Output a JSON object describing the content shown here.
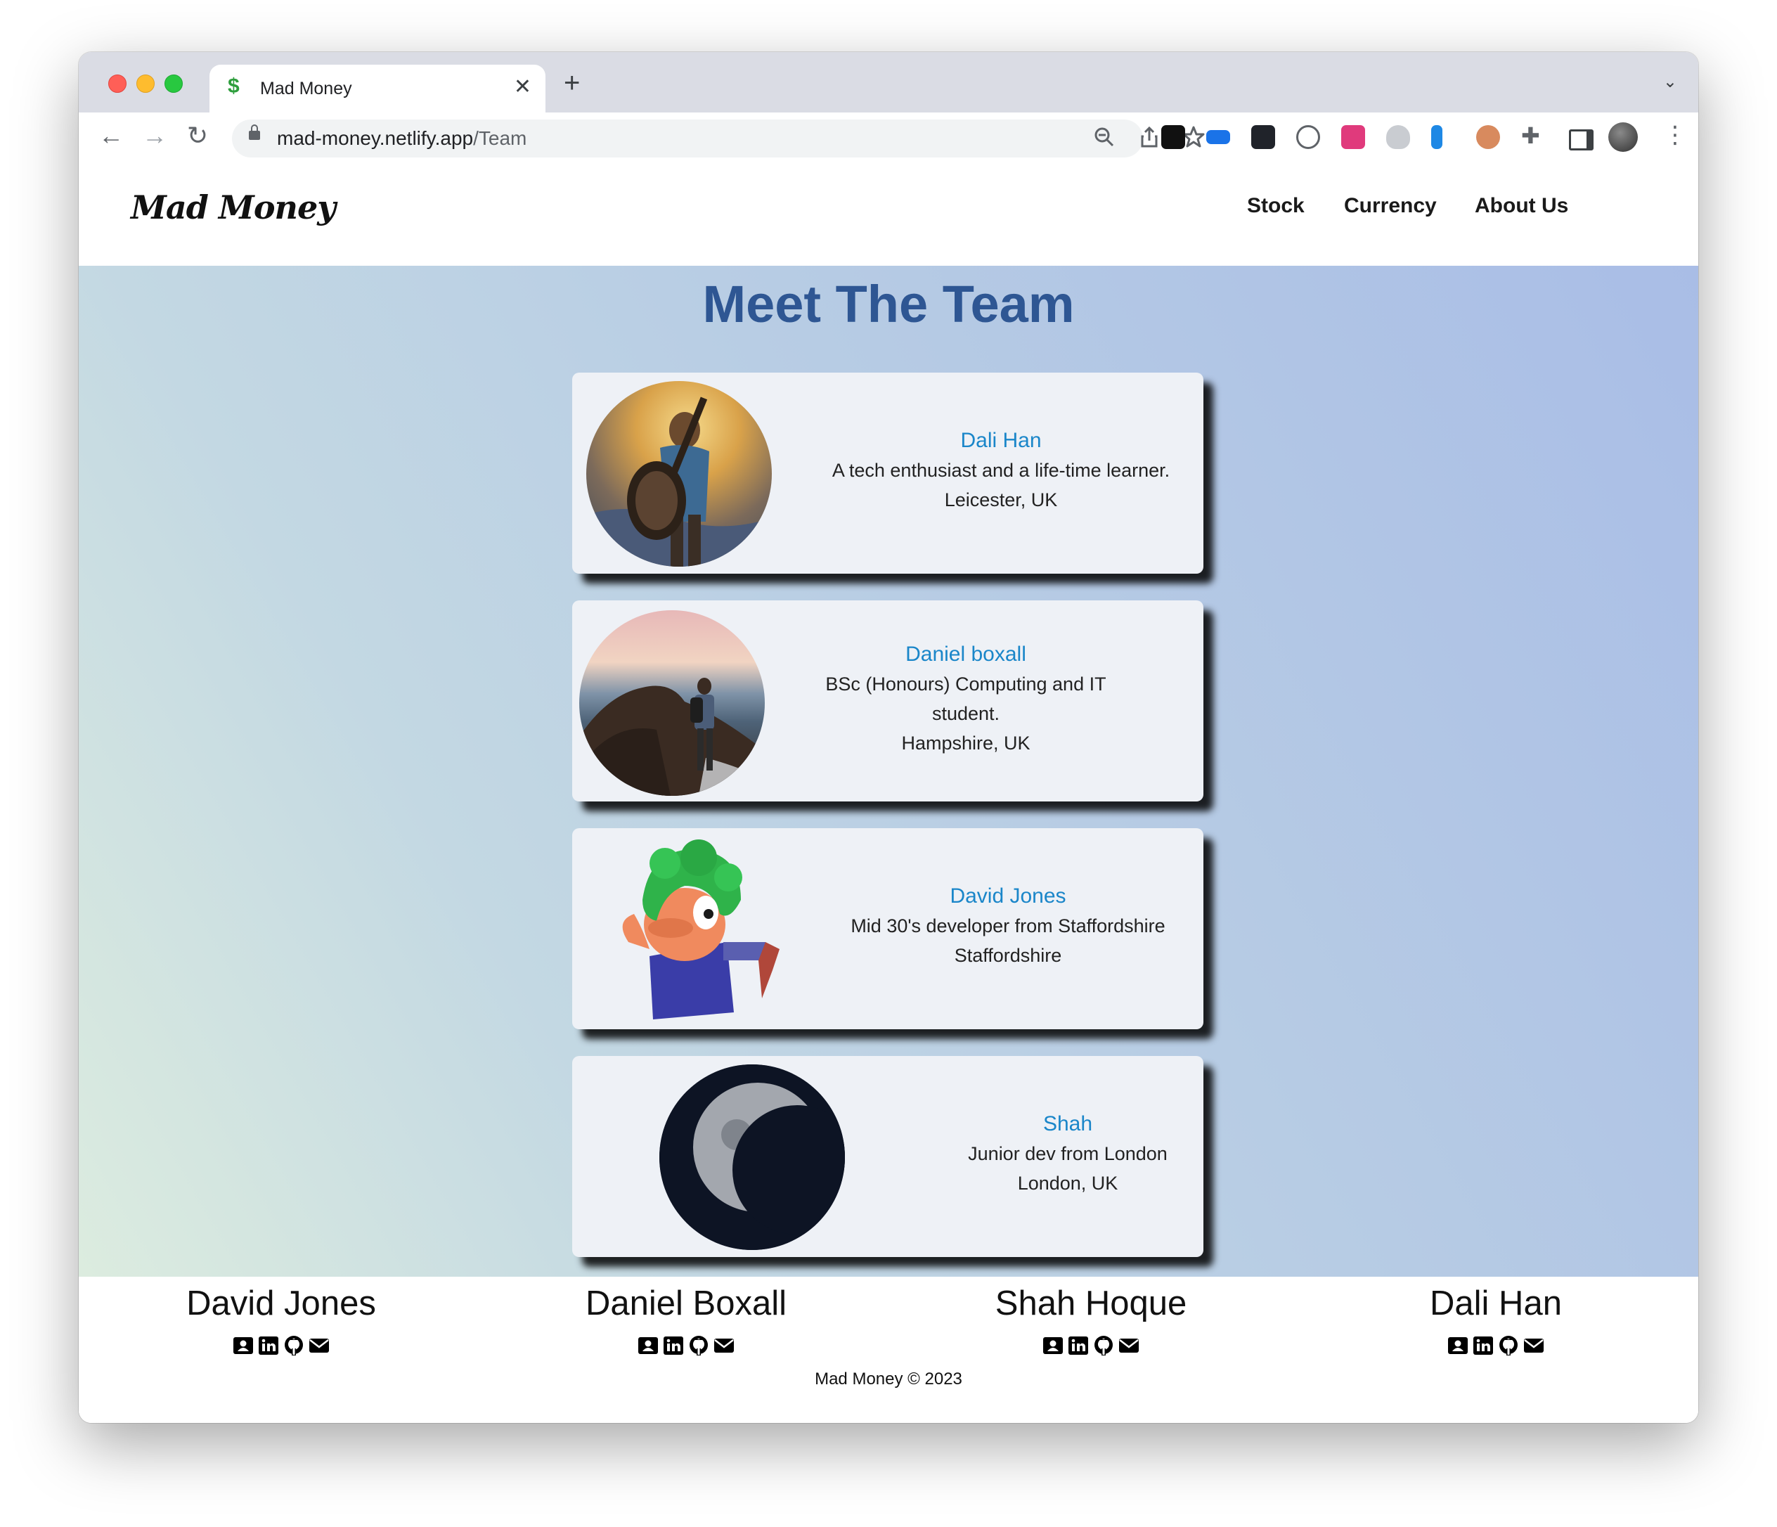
{
  "browser": {
    "tab_title": "Mad Money",
    "tab_favicon": "$",
    "url_host": "mad-money.netlify.app",
    "url_path": "/Team",
    "toolbar_icons": [
      "back-icon",
      "forward-icon",
      "reload-icon",
      "lock-icon",
      "zoom-icon",
      "share-icon",
      "bookmark-star-icon",
      "extensions-puzzle-icon",
      "side-panel-icon",
      "profile-avatar",
      "kebab-menu-icon"
    ]
  },
  "site": {
    "logo": "Mad Money",
    "nav": [
      {
        "label": "Stock"
      },
      {
        "label": "Currency"
      },
      {
        "label": "About Us"
      }
    ]
  },
  "hero": {
    "title": "Meet The Team"
  },
  "team": [
    {
      "name": "Dali Han",
      "lines": [
        "A tech enthusiast and a life-time learner.",
        "Leicester, UK"
      ],
      "photo": "adventurer-with-guitar"
    },
    {
      "name": "Daniel boxall",
      "lines": [
        "BSc (Honours) Computing and IT",
        "student.",
        "Hampshire, UK"
      ],
      "photo": "hiker-on-sea-cliff"
    },
    {
      "name": "David Jones",
      "lines": [
        "Mid 30's developer from Staffordshire",
        "Staffordshire"
      ],
      "photo": "green-haired-lemming"
    },
    {
      "name": "Shah",
      "lines": [
        "Junior dev from London",
        "London, UK"
      ],
      "photo": "moon"
    }
  ],
  "footer": {
    "members": [
      {
        "name": "David Jones"
      },
      {
        "name": "Daniel Boxall"
      },
      {
        "name": "Shah Hoque"
      },
      {
        "name": "Dali Han"
      }
    ],
    "icon_names": [
      "contact-card-icon",
      "linkedin-icon",
      "github-icon",
      "email-icon"
    ],
    "copyright": "Mad Money © 2023"
  },
  "colors": {
    "accent_name": "#1a86c9",
    "hero_title": "#2e5693",
    "card_bg": "#eef1f6"
  }
}
